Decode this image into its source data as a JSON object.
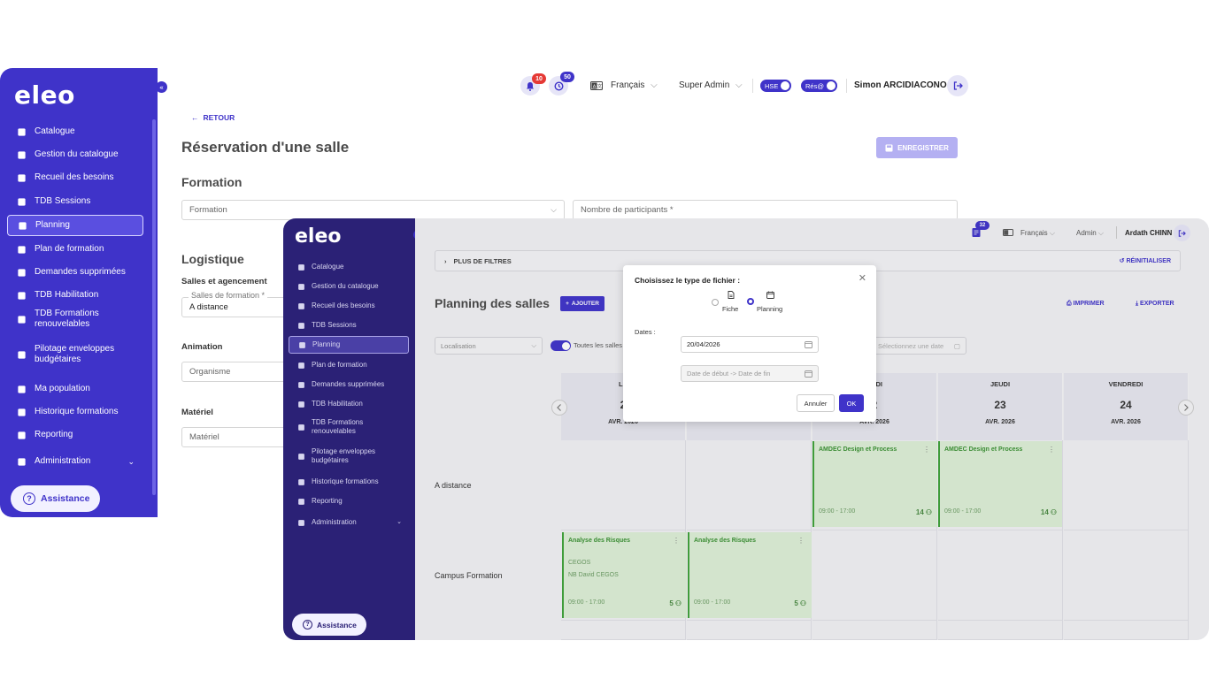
{
  "back": {
    "logo": "eleo",
    "nav": [
      {
        "label": "Catalogue",
        "icon": "book-icon"
      },
      {
        "label": "Gestion du catalogue",
        "icon": "catalog-manage-icon"
      },
      {
        "label": "Recueil des besoins",
        "icon": "clipboard-icon"
      },
      {
        "label": "TDB Sessions",
        "icon": "calendar-check-icon"
      },
      {
        "label": "Planning",
        "icon": "calendar-icon",
        "active": true
      },
      {
        "label": "Plan de formation",
        "icon": "org-chart-icon"
      },
      {
        "label": "Demandes supprimées",
        "icon": "trash-icon"
      },
      {
        "label": "TDB Habilitation",
        "icon": "habilitation-icon"
      },
      {
        "label": "TDB Formations renouvelables",
        "icon": "renew-icon"
      },
      {
        "label": "Pilotage enveloppes budgétaires",
        "icon": "group-icon"
      },
      {
        "label": "Ma population",
        "icon": "users-icon"
      },
      {
        "label": "Historique formations",
        "icon": "history-icon"
      },
      {
        "label": "Reporting",
        "icon": "pie-chart-icon"
      },
      {
        "label": "Administration",
        "icon": "gear-icon"
      }
    ],
    "assistance": "Assistance",
    "topbar": {
      "notif_count": "10",
      "alerts_count": "50",
      "language": "Français",
      "role": "Super Admin",
      "toggle1": "HSE",
      "toggle2": "Rés@",
      "user": "Simon ARCIDIACONO"
    },
    "back_link": "RETOUR",
    "title": "Réservation d'une salle",
    "save": "ENREGISTRER",
    "formation_section": "Formation",
    "formation_placeholder": "Formation",
    "participants_placeholder": "Nombre de participants *",
    "logistique": "Logistique",
    "salles_label": "Salles et agencement",
    "salles_field_label": "Salles de formation *",
    "salles_value": "A distance",
    "animation": "Animation",
    "organisme_placeholder": "Organisme",
    "materiel": "Matériel",
    "materiel_placeholder": "Matériel"
  },
  "front": {
    "logo": "eleo",
    "nav": [
      {
        "label": "Catalogue"
      },
      {
        "label": "Gestion du catalogue"
      },
      {
        "label": "Recueil des besoins"
      },
      {
        "label": "TDB Sessions"
      },
      {
        "label": "Planning",
        "active": true
      },
      {
        "label": "Plan de formation"
      },
      {
        "label": "Demandes supprimées"
      },
      {
        "label": "TDB Habilitation"
      },
      {
        "label": "TDB Formations renouvelables"
      },
      {
        "label": "Pilotage enveloppes budgétaires"
      },
      {
        "label": "Historique formations"
      },
      {
        "label": "Reporting"
      },
      {
        "label": "Administration"
      }
    ],
    "assistance": "Assistance",
    "topbar": {
      "badge": "32",
      "language": "Français",
      "role": "Admin",
      "user": "Ardath CHINN"
    },
    "filters": "PLUS DE FILTRES",
    "reset": "RÉINITIALISER",
    "title": "Planning des salles",
    "add": "AJOUTER",
    "print": "IMPRIMER",
    "export": "EXPORTER",
    "localisation": "Localisation",
    "toutes_salles": "Toutes les salles",
    "date_placeholder": "Sélectionnez une date",
    "days": [
      {
        "d": "LU",
        "n": "2",
        "m": "AVR. 2026"
      },
      {
        "d": "",
        "n": "",
        "m": "AVR. 2026"
      },
      {
        "d": "REDI",
        "n": "2",
        "m": "AVR. 2026"
      },
      {
        "d": "JEUDI",
        "n": "23",
        "m": "AVR. 2026"
      },
      {
        "d": "VENDREDI",
        "n": "24",
        "m": "AVR. 2026"
      }
    ],
    "rows": [
      "A distance",
      "Campus Formation"
    ],
    "events": [
      {
        "title": "AMDEC Design et Process",
        "time": "09:00 - 17:00",
        "count": "14"
      },
      {
        "title": "AMDEC Design et Process",
        "time": "09:00 - 17:00",
        "count": "14"
      },
      {
        "title": "Analyse des Risques",
        "org": "CEGOS",
        "person": "NB David CEGOS",
        "time": "09:00 - 17:00",
        "count": "5"
      },
      {
        "title": "Analyse des Risques",
        "time": "09:00 - 17:00",
        "count": "5"
      }
    ]
  },
  "modal": {
    "title": "Choisissez le type de fichier :",
    "opt1": "Fiche",
    "opt2": "Planning",
    "dates_label": "Dates :",
    "date_value": "20/04/2026",
    "range_placeholder": "Date de début -> Date de fin",
    "cancel": "Annuler",
    "ok": "OK"
  }
}
